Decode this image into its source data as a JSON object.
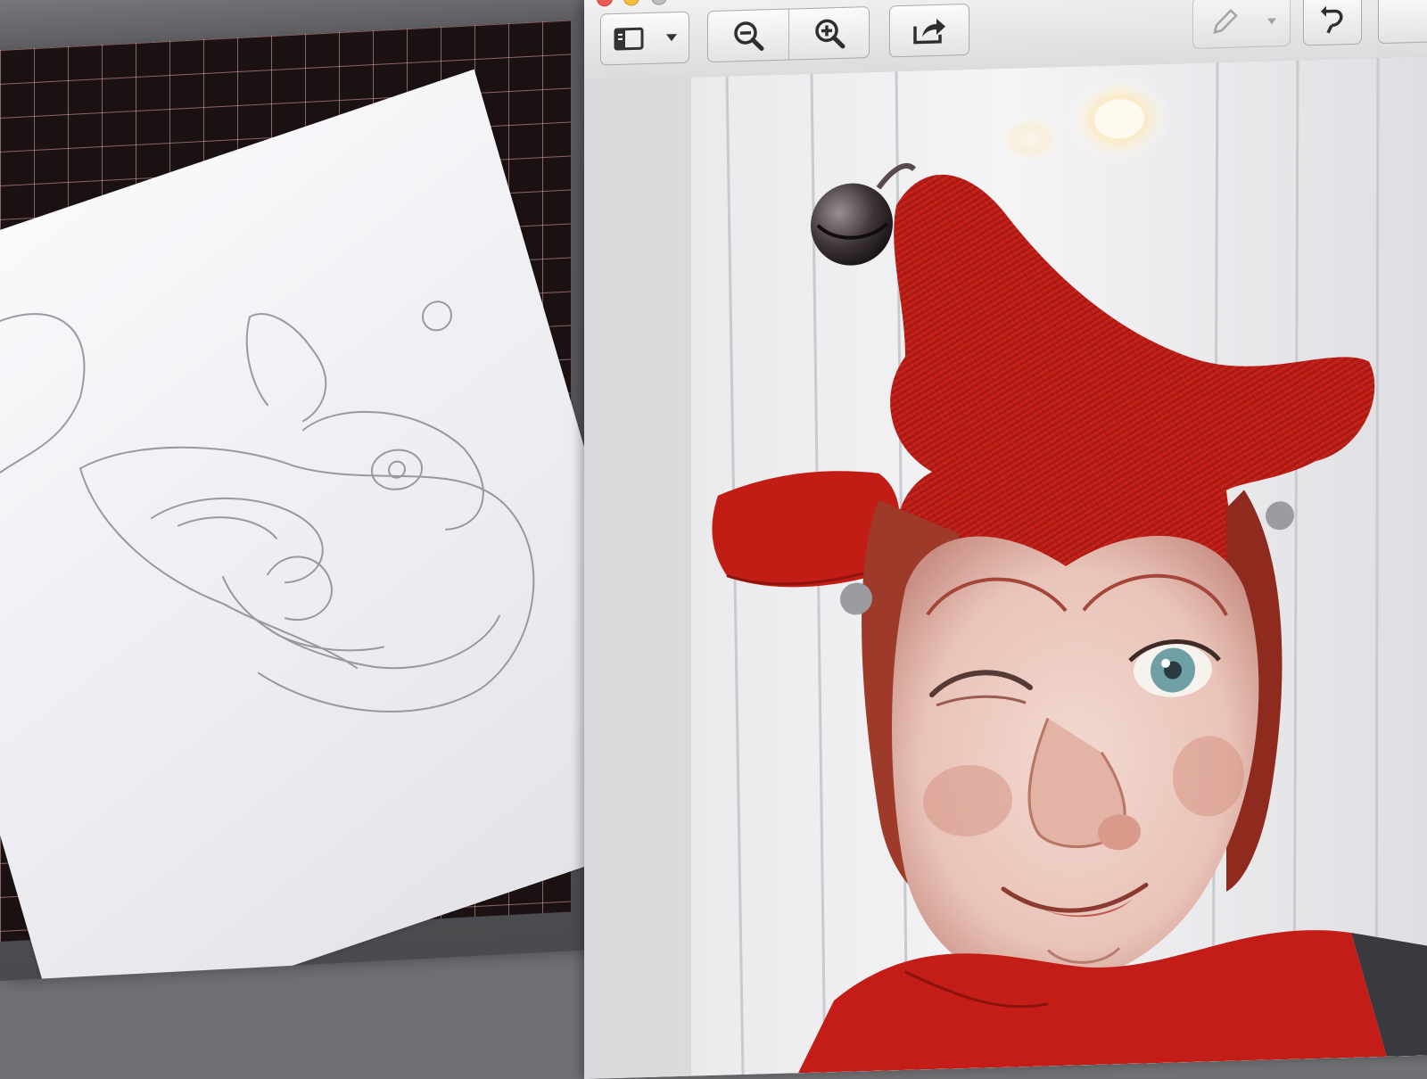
{
  "left_window": {
    "content": "sketch-photo"
  },
  "viewer": {
    "toolbar": {
      "sidebar_icon": "sidebar-icon",
      "dropdown_icon": "chevron-down-icon",
      "zoom_out_icon": "zoom-out-icon",
      "zoom_in_icon": "zoom-in-icon",
      "share_icon": "share-icon",
      "markup_icon": "pencil-icon",
      "rotate_icon": "rotate-icon"
    },
    "image": {
      "subject": "jester-puppet-photo"
    },
    "colors": {
      "jester_red": "#c41c16",
      "toolbar_bg": "#e6e6e8",
      "mat_dark": "#1c1213"
    }
  }
}
